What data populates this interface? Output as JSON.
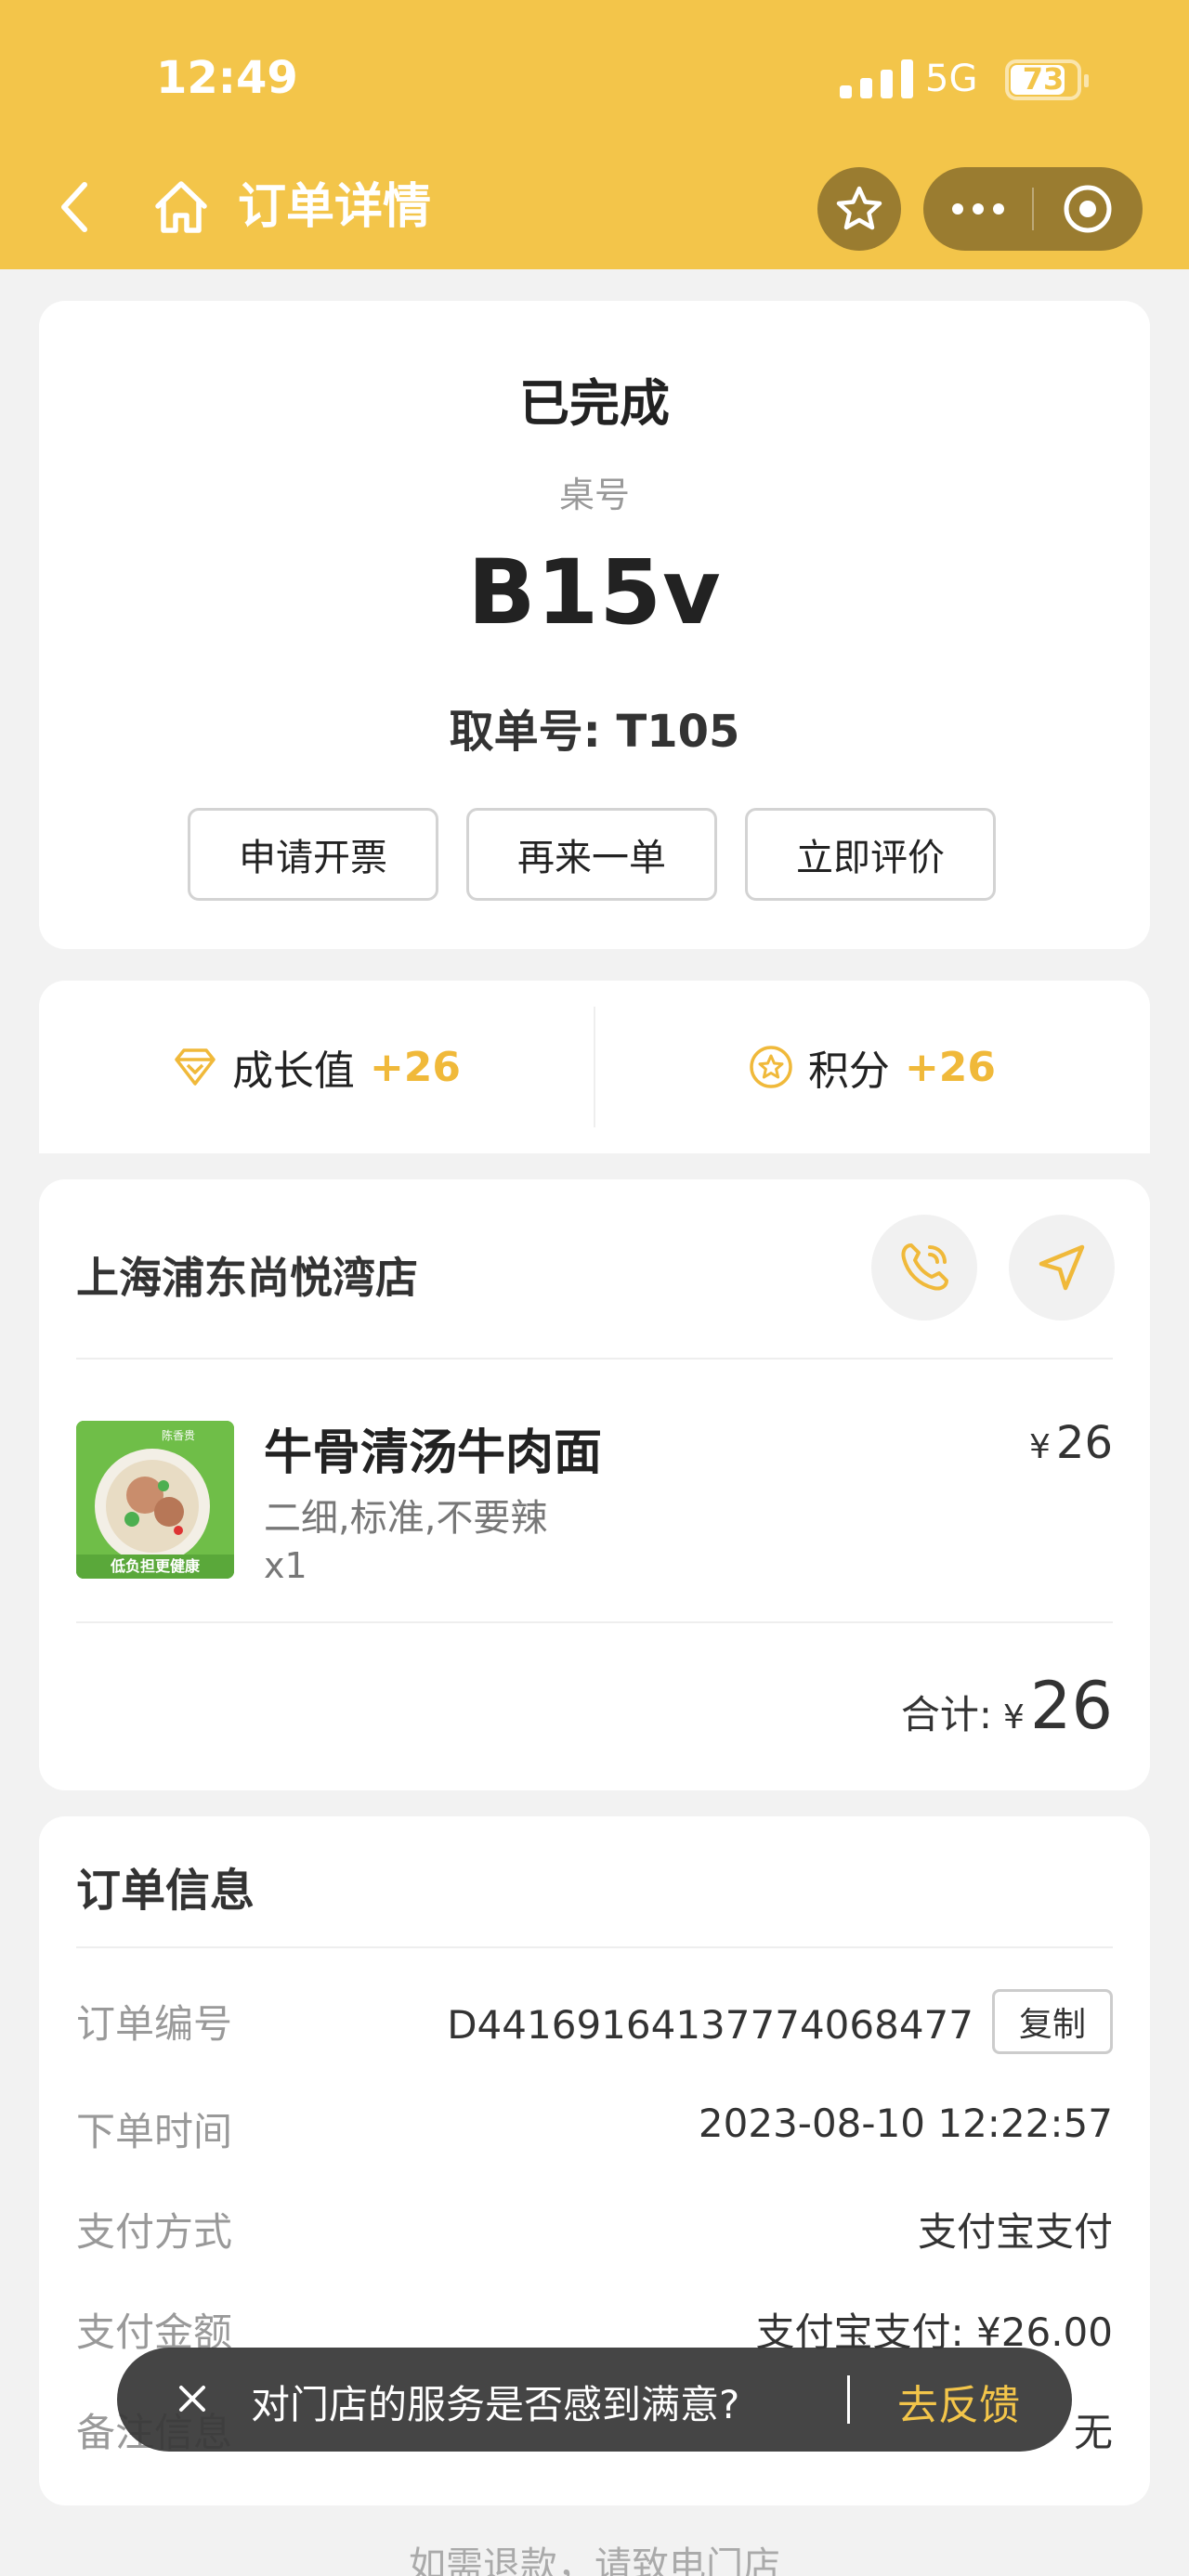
{
  "status_bar": {
    "time": "12:49",
    "network": "5G",
    "battery": "73"
  },
  "nav": {
    "title": "订单详情"
  },
  "order": {
    "status": "已完成",
    "table_label": "桌号",
    "table_number": "B15v",
    "pickup": "取单号: T105",
    "actions": [
      "申请开票",
      "再来一单",
      "立即评价"
    ]
  },
  "rewards": {
    "growth_label": "成长值",
    "growth_value": "+26",
    "points_label": "积分",
    "points_value": "+26"
  },
  "store": {
    "name": "上海浦东尚悦湾店",
    "item": {
      "name": "牛骨清汤牛肉面",
      "spec": "二细,标准,不要辣",
      "qty": "x1",
      "currency": "¥",
      "price": "26",
      "image_banner": "低负担更健康",
      "image_brand": "陈香贵"
    },
    "total_label": "合计:",
    "total_currency": "¥",
    "total_value": "26"
  },
  "info": {
    "title": "订单信息",
    "order_no_label": "订单编号",
    "order_no": "D44169164137774068477",
    "copy_label": "复制",
    "time_label": "下单时间",
    "time": "2023-08-10 12:22:57",
    "pay_method_label": "支付方式",
    "pay_method": "支付宝支付",
    "pay_amount_label": "支付金额",
    "pay_amount": "支付宝支付: ¥26.00",
    "remark_label": "备注信息",
    "remark": "无"
  },
  "toast": {
    "message": "对门店的服务是否感到满意?",
    "action": "去反馈"
  },
  "footer": {
    "text": "如需退款，请致电门店"
  },
  "colors": {
    "brand": "#f3c54a",
    "accent": "#f0b93a"
  }
}
